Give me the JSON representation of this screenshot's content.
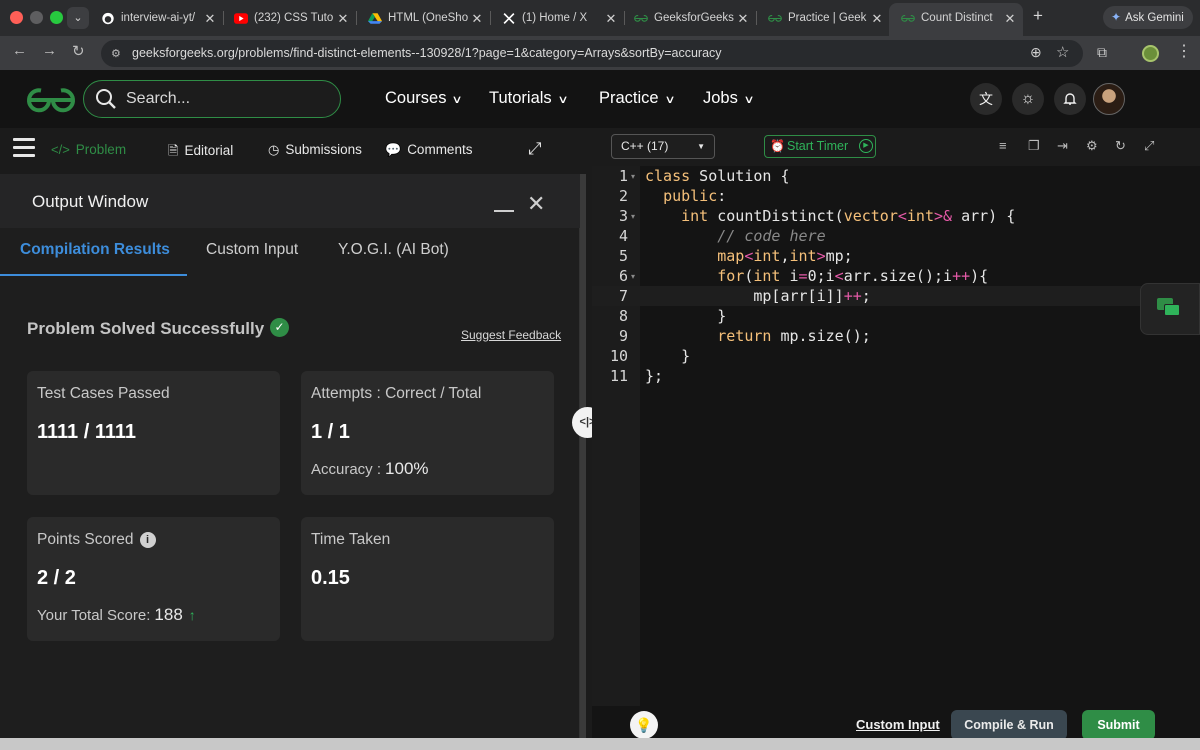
{
  "browser": {
    "tabs": [
      {
        "title": "interview-ai-yt/",
        "icon": "github-icon",
        "color": "#ffffff"
      },
      {
        "title": "(232) CSS Tuto",
        "icon": "youtube-icon",
        "color": "#ff0000"
      },
      {
        "title": "HTML (OneShot",
        "icon": "google-drive-icon",
        "color": "#fbbc04"
      },
      {
        "title": "(1) Home / X",
        "icon": "x-icon",
        "color": "#ffffff"
      },
      {
        "title": "GeeksforGeeks",
        "icon": "gfg-icon",
        "color": "#2f8d46"
      },
      {
        "title": "Practice | Geek",
        "icon": "gfg-icon",
        "color": "#2f8d46"
      },
      {
        "title": "Count Distinct",
        "icon": "gfg-icon",
        "color": "#2f8d46",
        "active": true
      }
    ],
    "new_tab": "+",
    "ask_gemini": "Ask Gemini",
    "url": "geeksforgeeks.org/problems/find-distinct-elements--130928/1?page=1&category=Arrays&sortBy=accuracy"
  },
  "header": {
    "search_placeholder": "Search...",
    "nav": [
      "Courses",
      "Tutorials",
      "Practice",
      "Jobs"
    ]
  },
  "problem_tabs": [
    {
      "label": "Problem",
      "icon": "code-icon",
      "active": true
    },
    {
      "label": "Editorial",
      "icon": "document-icon"
    },
    {
      "label": "Submissions",
      "icon": "clock-icon"
    },
    {
      "label": "Comments",
      "icon": "comment-icon"
    }
  ],
  "output": {
    "title": "Output Window",
    "tabs": [
      "Compilation Results",
      "Custom Input",
      "Y.O.G.I. (AI Bot)"
    ],
    "status": "Problem Solved Successfully",
    "feedback": "Suggest Feedback",
    "cards": {
      "tests": {
        "title": "Test Cases Passed",
        "value": "1111 / 1111"
      },
      "attempts": {
        "title": "Attempts : Correct / Total",
        "value": "1 / 1",
        "sub_label": "Accuracy :",
        "sub_value": "100%"
      },
      "points": {
        "title": "Points Scored",
        "value": "2 / 2",
        "sub_label": "Your Total Score:",
        "sub_value": "188"
      },
      "time": {
        "title": "Time Taken",
        "value": "0.15"
      }
    }
  },
  "editor": {
    "language": "C++ (17)",
    "timer": "Start Timer",
    "line_numbers": [
      "1",
      "2",
      "3",
      "4",
      "5",
      "6",
      "7",
      "8",
      "9",
      "10",
      "11"
    ],
    "lines": [
      "class Solution {",
      "  public:",
      "    int countDistinct(vector<int>& arr) {",
      "        // code here",
      "        map<int,int>mp;",
      "        for(int i=0;i<arr.size();i++){",
      "            mp[arr[i]]++;",
      "        }",
      "        return mp.size();",
      "    }",
      "};"
    ],
    "custom_input": "Custom Input",
    "compile_run": "Compile & Run",
    "submit": "Submit"
  }
}
